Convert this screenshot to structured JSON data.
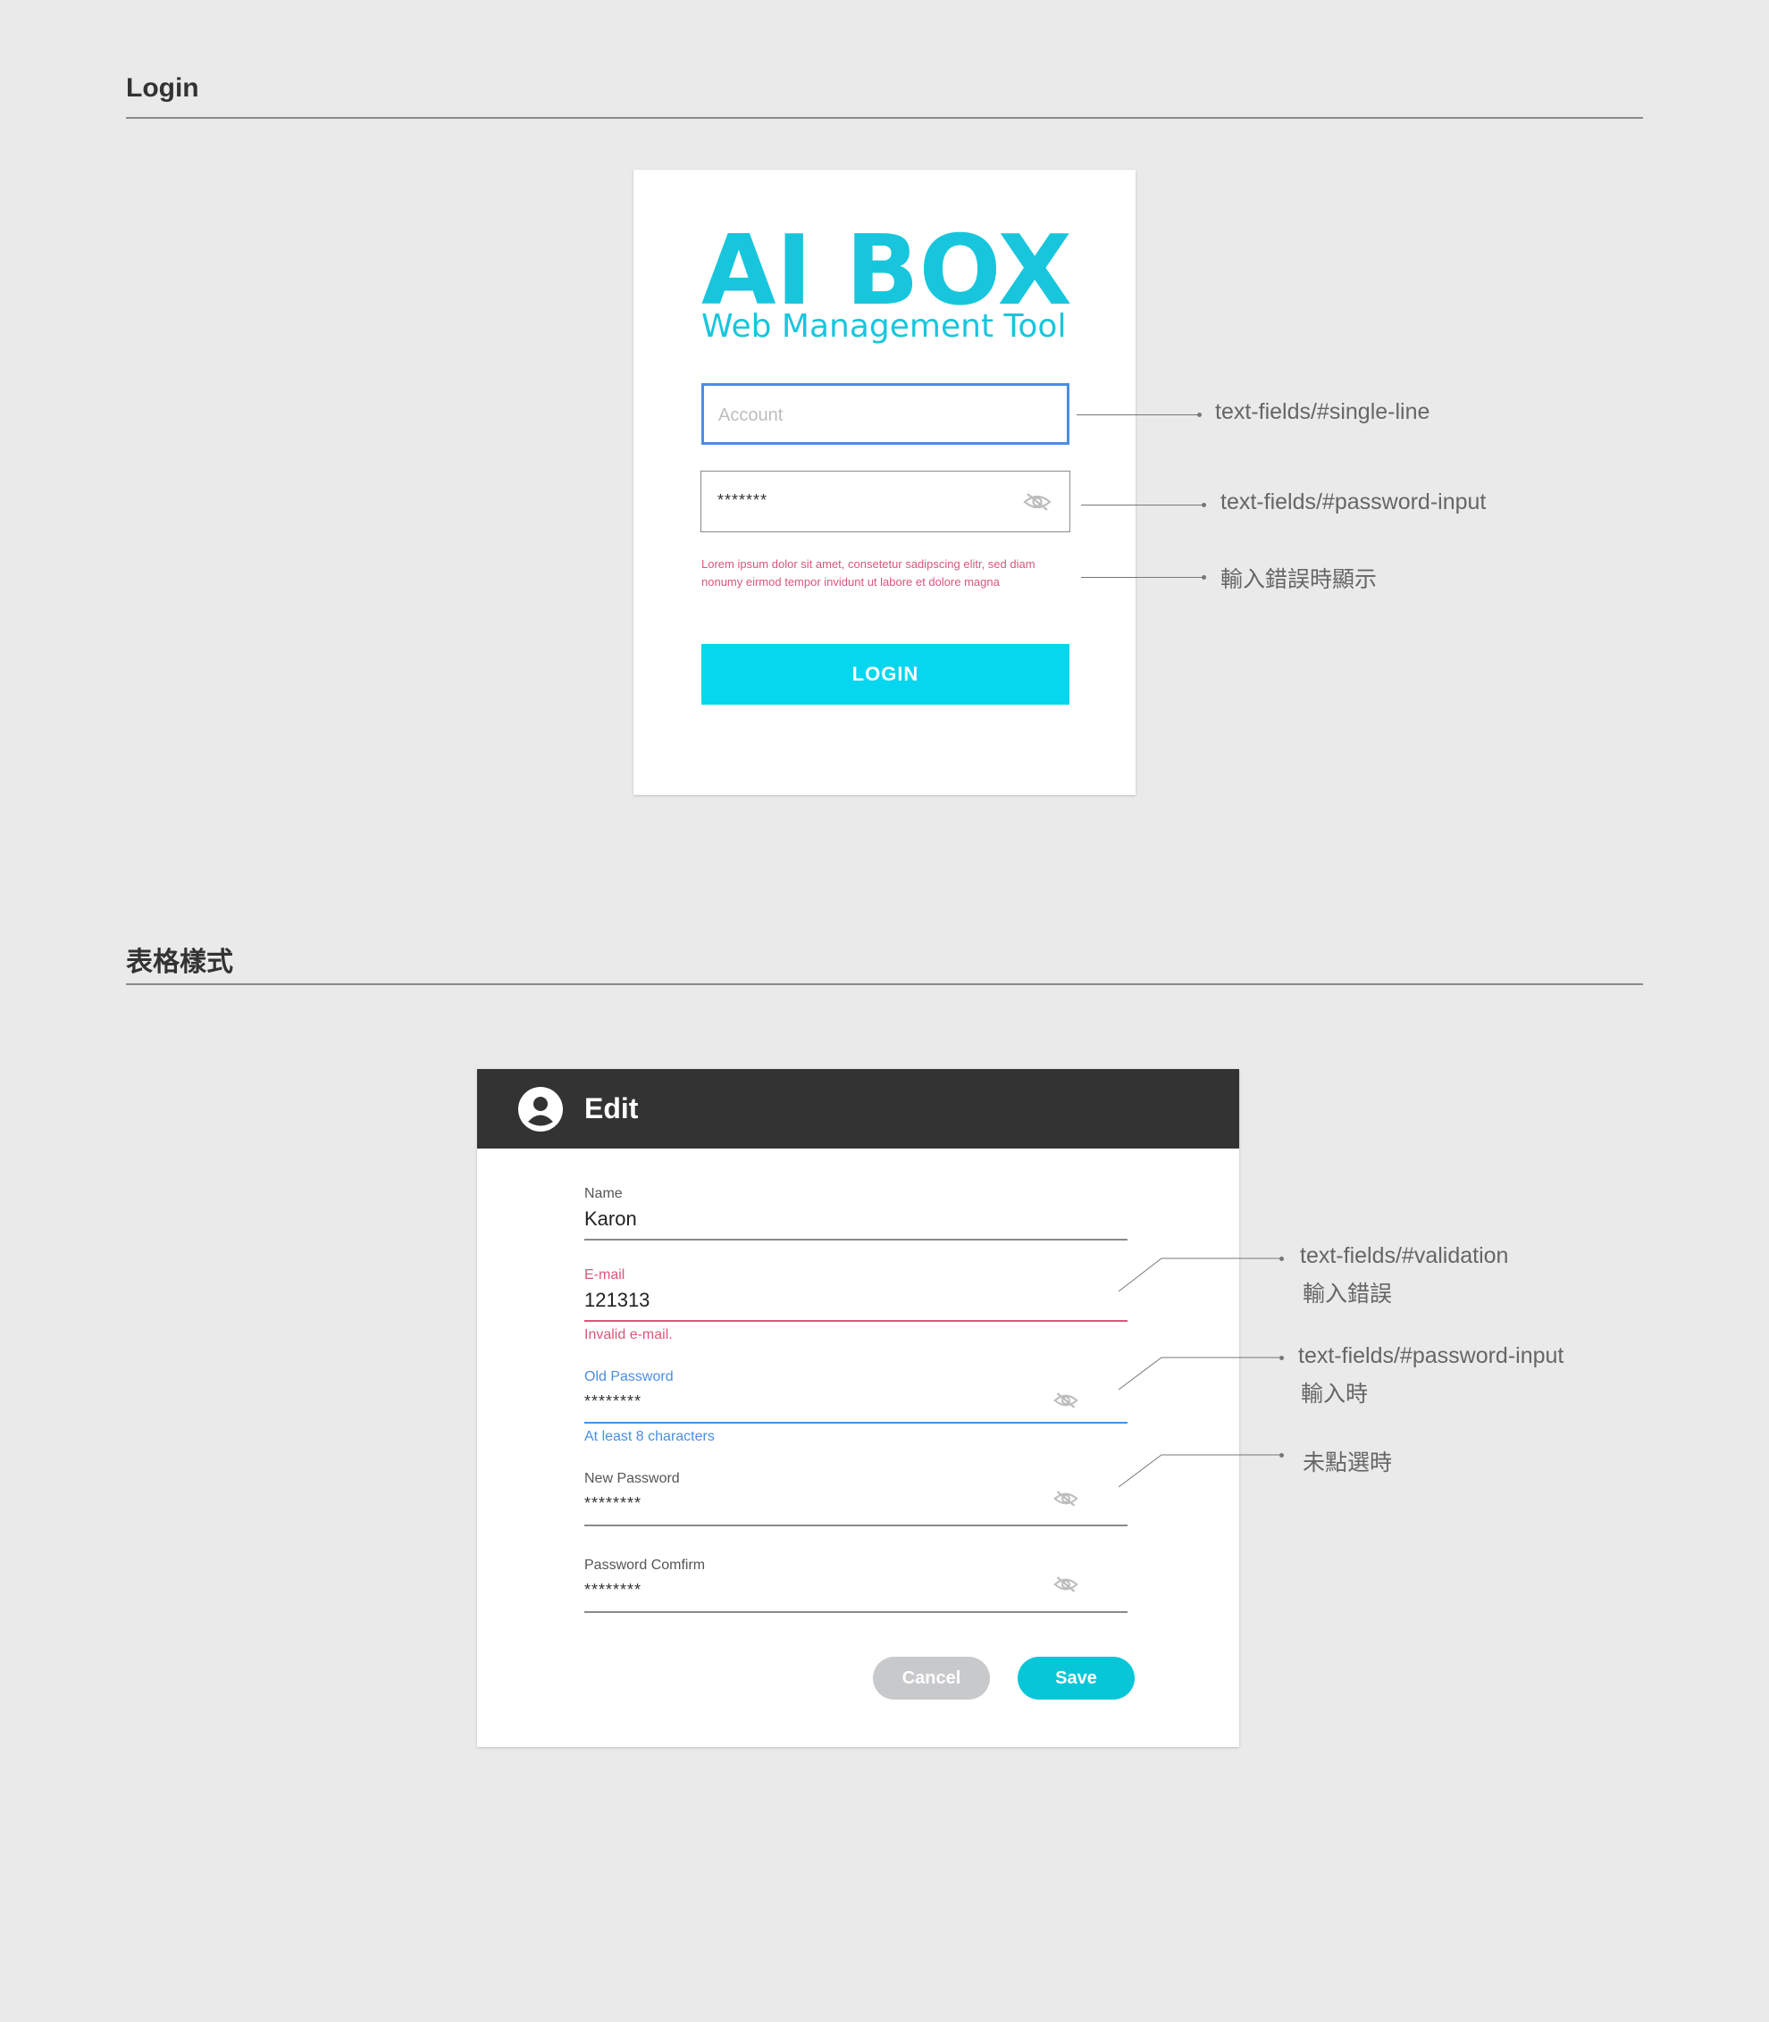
{
  "sections": {
    "login_title": "Login",
    "form_title": "表格樣式"
  },
  "login": {
    "logo_title": "AI BOX",
    "logo_subtitle": "Web Management Tool",
    "account_placeholder": "Account",
    "password_value": "*******",
    "error_text": "Lorem ipsum dolor sit amet, consetetur sadipscing elitr, sed diam nonumy eirmod tempor invidunt ut labore et dolore magna",
    "button_label": "LOGIN",
    "icons": {
      "password_toggle": "eye-off-icon"
    },
    "colors": {
      "brand": "#17c6dc",
      "button": "#06d6ee",
      "focus": "#4a8ee0",
      "error": "#d9577a"
    }
  },
  "login_annotations": [
    {
      "text": "text-fields/#single-line"
    },
    {
      "text": "text-fields/#password-input"
    },
    {
      "text": "輸入錯誤時顯示"
    }
  ],
  "edit": {
    "header_title": "Edit",
    "header_icon": "account-circle-icon",
    "fields": {
      "name": {
        "label": "Name",
        "value": "Karon"
      },
      "email": {
        "label": "E-mail",
        "value": "121313",
        "helper": "Invalid e-mail."
      },
      "old_password": {
        "label": "Old Password",
        "value": "********",
        "helper": "At least 8 characters"
      },
      "new_password": {
        "label": "New Password",
        "value": "********"
      },
      "confirm_password": {
        "label": "Password Comfirm",
        "value": "********"
      }
    },
    "cancel_label": "Cancel",
    "save_label": "Save",
    "colors": {
      "header": "#333333",
      "save": "#06c6d8",
      "cancel": "#c8c9cb",
      "error": "#d9577a",
      "active": "#4a8ee0"
    }
  },
  "edit_annotations": [
    {
      "line1": "text-fields/#validation",
      "line2": "輸入錯誤"
    },
    {
      "line1": "text-fields/#password-input",
      "line2": "輸入時"
    },
    {
      "line1": "未點選時"
    }
  ]
}
